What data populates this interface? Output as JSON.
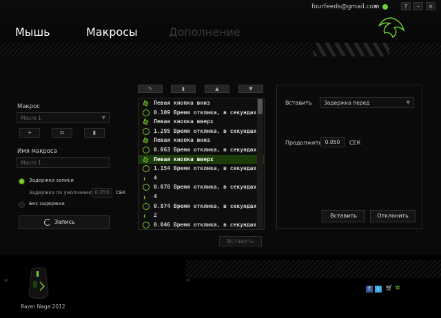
{
  "header": {
    "email": "fourfeeds@gmail.com",
    "window_buttons": [
      "?",
      "–",
      "✕"
    ],
    "tabs": [
      {
        "label": "Мышь",
        "active": false
      },
      {
        "label": "Макросы",
        "active": true
      },
      {
        "label": "Дополнение",
        "active": false
      }
    ]
  },
  "left": {
    "macro_label": "Макрос",
    "macro_select": "Macro 1",
    "name_label": "Имя макроса",
    "name_value": "Macro 1",
    "radio_record_delay": "Задержка записи",
    "radio_default_delay": "Задержка по умолчанию",
    "default_delay_value": "0.050",
    "default_delay_unit": "СЕК",
    "radio_no_delay": "Без задержки",
    "record_button": "Запись"
  },
  "list": {
    "items": [
      {
        "icon": "mouse-icon",
        "text": "Левая кнопка вниз"
      },
      {
        "icon": "clock-icon",
        "text": "0.109 Время отклика, в секундах"
      },
      {
        "icon": "mouse-icon",
        "text": "Левая кнопка вверх"
      },
      {
        "icon": "clock-icon",
        "text": "1.295 Время отклика, в секундах"
      },
      {
        "icon": "mouse-icon",
        "text": "Левая кнопка вниз"
      },
      {
        "icon": "clock-icon",
        "text": "0.063 Время отклика, в секундах"
      },
      {
        "icon": "mouse-icon",
        "text": "Левая кнопка вверх",
        "selected": true
      },
      {
        "icon": "clock-icon",
        "text": "1.154 Время отклика, в секундах"
      },
      {
        "icon": "arrow-down-icon",
        "text": "4"
      },
      {
        "icon": "clock-icon",
        "text": "0.078 Время отклика, в секундах"
      },
      {
        "icon": "arrow-up-icon",
        "text": "4"
      },
      {
        "icon": "clock-icon",
        "text": "0.874 Время отклика, в секундах"
      },
      {
        "icon": "arrow-down-icon",
        "text": "2"
      },
      {
        "icon": "clock-icon",
        "text": "0.046 Время отклика, в секундах"
      }
    ],
    "insert_button": "Вставить"
  },
  "right": {
    "insert_label": "Вставить",
    "insert_select": "Задержка перед",
    "duration_label": "Продолжить",
    "duration_value": "0.050",
    "duration_unit": "СЕК",
    "insert_button": "Вставить",
    "cancel_button": "Отклонить"
  },
  "footer": {
    "device_name": "Razer Naga 2012"
  },
  "colors": {
    "accent": "#7ecb2a",
    "selected_row": "#1c3d0a"
  }
}
